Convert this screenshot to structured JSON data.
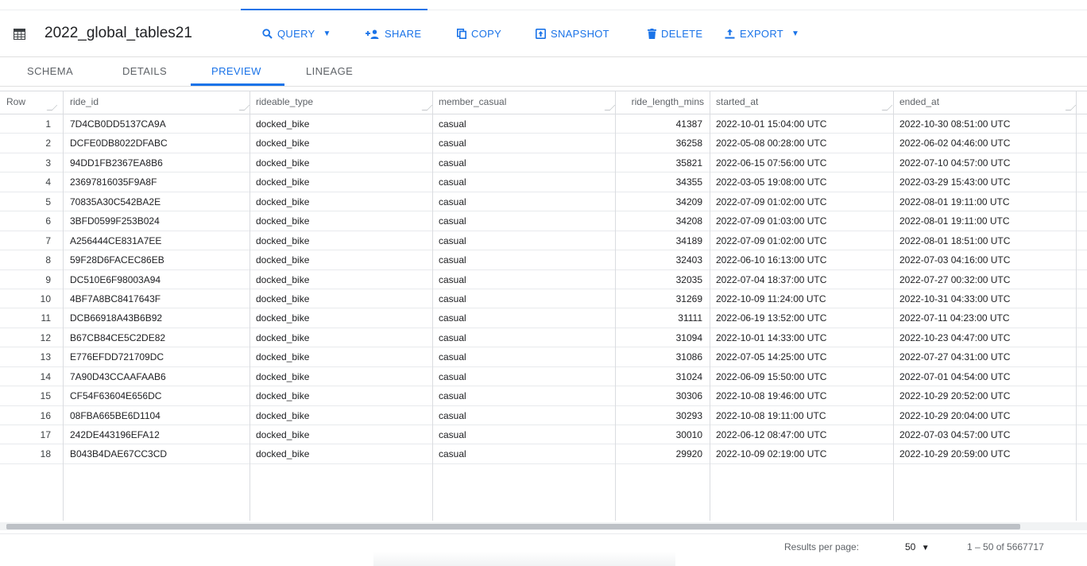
{
  "header": {
    "title": "2022_global_tables21",
    "toolbar": [
      {
        "id": "query",
        "label": "QUERY",
        "icon": "search-icon",
        "dropdown": true
      },
      {
        "id": "share",
        "label": "SHARE",
        "icon": "person-add-icon",
        "dropdown": false
      },
      {
        "id": "copy",
        "label": "COPY",
        "icon": "copy-icon",
        "dropdown": false
      },
      {
        "id": "snapshot",
        "label": "SNAPSHOT",
        "icon": "snapshot-icon",
        "dropdown": false
      },
      {
        "id": "delete",
        "label": "DELETE",
        "icon": "trash-icon",
        "dropdown": false
      },
      {
        "id": "export",
        "label": "EXPORT",
        "icon": "export-icon",
        "dropdown": true
      }
    ]
  },
  "tabs": [
    {
      "label": "SCHEMA",
      "active": false
    },
    {
      "label": "DETAILS",
      "active": false
    },
    {
      "label": "PREVIEW",
      "active": true
    },
    {
      "label": "LINEAGE",
      "active": false
    }
  ],
  "table": {
    "columns": [
      "Row",
      "ride_id",
      "rideable_type",
      "member_casual",
      "ride_length_mins",
      "started_at",
      "ended_at"
    ],
    "rows": [
      [
        "1",
        "7D4CB0DD5137CA9A",
        "docked_bike",
        "casual",
        "41387",
        "2022-10-01 15:04:00 UTC",
        "2022-10-30 08:51:00 UTC"
      ],
      [
        "2",
        "DCFE0DB8022DFABC",
        "docked_bike",
        "casual",
        "36258",
        "2022-05-08 00:28:00 UTC",
        "2022-06-02 04:46:00 UTC"
      ],
      [
        "3",
        "94DD1FB2367EA8B6",
        "docked_bike",
        "casual",
        "35821",
        "2022-06-15 07:56:00 UTC",
        "2022-07-10 04:57:00 UTC"
      ],
      [
        "4",
        "23697816035F9A8F",
        "docked_bike",
        "casual",
        "34355",
        "2022-03-05 19:08:00 UTC",
        "2022-03-29 15:43:00 UTC"
      ],
      [
        "5",
        "70835A30C542BA2E",
        "docked_bike",
        "casual",
        "34209",
        "2022-07-09 01:02:00 UTC",
        "2022-08-01 19:11:00 UTC"
      ],
      [
        "6",
        "3BFD0599F253B024",
        "docked_bike",
        "casual",
        "34208",
        "2022-07-09 01:03:00 UTC",
        "2022-08-01 19:11:00 UTC"
      ],
      [
        "7",
        "A256444CE831A7EE",
        "docked_bike",
        "casual",
        "34189",
        "2022-07-09 01:02:00 UTC",
        "2022-08-01 18:51:00 UTC"
      ],
      [
        "8",
        "59F28D6FACEC86EB",
        "docked_bike",
        "casual",
        "32403",
        "2022-06-10 16:13:00 UTC",
        "2022-07-03 04:16:00 UTC"
      ],
      [
        "9",
        "DC510E6F98003A94",
        "docked_bike",
        "casual",
        "32035",
        "2022-07-04 18:37:00 UTC",
        "2022-07-27 00:32:00 UTC"
      ],
      [
        "10",
        "4BF7A8BC8417643F",
        "docked_bike",
        "casual",
        "31269",
        "2022-10-09 11:24:00 UTC",
        "2022-10-31 04:33:00 UTC"
      ],
      [
        "11",
        "DCB66918A43B6B92",
        "docked_bike",
        "casual",
        "31111",
        "2022-06-19 13:52:00 UTC",
        "2022-07-11 04:23:00 UTC"
      ],
      [
        "12",
        "B67CB84CE5C2DE82",
        "docked_bike",
        "casual",
        "31094",
        "2022-10-01 14:33:00 UTC",
        "2022-10-23 04:47:00 UTC"
      ],
      [
        "13",
        "E776EFDD721709DC",
        "docked_bike",
        "casual",
        "31086",
        "2022-07-05 14:25:00 UTC",
        "2022-07-27 04:31:00 UTC"
      ],
      [
        "14",
        "7A90D43CCAAFAAB6",
        "docked_bike",
        "casual",
        "31024",
        "2022-06-09 15:50:00 UTC",
        "2022-07-01 04:54:00 UTC"
      ],
      [
        "15",
        "CF54F63604E656DC",
        "docked_bike",
        "casual",
        "30306",
        "2022-10-08 19:46:00 UTC",
        "2022-10-29 20:52:00 UTC"
      ],
      [
        "16",
        "08FBA665BE6D1104",
        "docked_bike",
        "casual",
        "30293",
        "2022-10-08 19:11:00 UTC",
        "2022-10-29 20:04:00 UTC"
      ],
      [
        "17",
        "242DE443196EFA12",
        "docked_bike",
        "casual",
        "30010",
        "2022-06-12 08:47:00 UTC",
        "2022-07-03 04:57:00 UTC"
      ],
      [
        "18",
        "B043B4DAE67CC3CD",
        "docked_bike",
        "casual",
        "29920",
        "2022-10-09 02:19:00 UTC",
        "2022-10-29 20:59:00 UTC"
      ]
    ]
  },
  "footer": {
    "results_per_page_label": "Results per page:",
    "results_per_page_value": "50",
    "range": "1 – 50 of 5667717"
  },
  "colors": {
    "accent": "#1a73e8",
    "text": "#202124",
    "muted": "#5f6368",
    "border": "#dadce0"
  }
}
